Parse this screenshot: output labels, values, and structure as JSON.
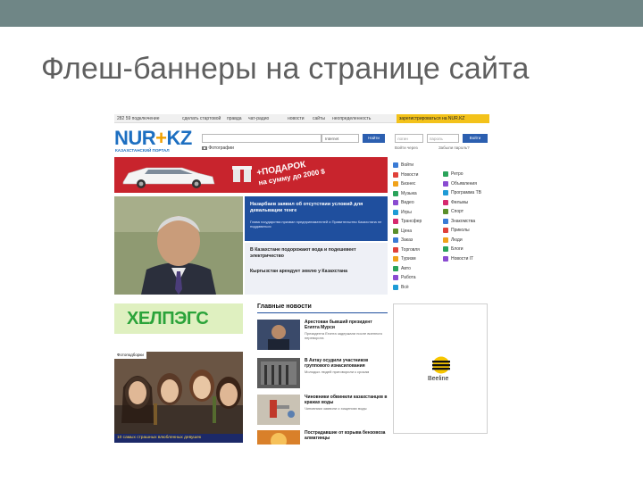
{
  "slide": {
    "title": "Флеш-баннеры на странице сайта"
  },
  "site": {
    "topbar": {
      "phone": "282 59 подключение",
      "links": [
        "сделать стартовой",
        "правда",
        "чат-радио",
        "новости",
        "сайты",
        "неопределенность"
      ],
      "register": "зарегистрироваться на NUR.KZ"
    },
    "logo": {
      "brand_left": "NUR",
      "brand_plus": "+",
      "brand_right": "KZ",
      "subtitle": "КАЗАХСТАНСКИЙ ПОРТАЛ"
    },
    "search": {
      "placeholder": "",
      "scope": "Internet",
      "button": "Найти",
      "photos_link": "Фотографии"
    },
    "login": {
      "login_placeholder": "логин",
      "password_placeholder": "пароль",
      "button": "Войти",
      "remember": "Войти через",
      "forgot": "Забыли пароль?"
    },
    "promo": {
      "line1": "+ПОДАРОК",
      "line2": "на сумму до 2000 $"
    },
    "feature": {
      "headline": "Назарбаев заявил об отсутствии условий для девальвации тенге",
      "subhead": "Глава государства призвал предпринимателей и Правительство Казахстана не поддаваться",
      "items": [
        "В Казахстане подорожают вода и подешевеет электричество",
        "Кыргызстан арендует землю у Казахстана"
      ]
    },
    "menu": {
      "col1": [
        "Войти",
        "Новости",
        "Бизнес",
        "Музыка",
        "Видео",
        "Игры",
        "Трансфер",
        "Ценa",
        "Заказ",
        "Торговля",
        "Туризм",
        "Авто",
        "Работа",
        "Всё"
      ],
      "col2": [
        "Ретро",
        "Объявления",
        "Программа ТВ",
        "Фильмы",
        "Спорт",
        "Знакомства",
        "Приколы",
        "Люди",
        "Блоги",
        "Новости IT"
      ]
    },
    "helpegs": {
      "text": "ХЕЛПЭГС"
    },
    "news": {
      "heading": "Главные новости",
      "items": [
        {
          "title": "Арестован бывший президент Египта Мурси",
          "desc": "Президента Египта задержали после военного переворота"
        },
        {
          "title": "В Актау осудили участников группового изнасилования",
          "desc": "Молодых людей приговорили к срокам"
        },
        {
          "title": "Чиновники обвинили казахстанцев в кражах воды",
          "desc": "Чиновники заявили о хищениях воды"
        },
        {
          "title": "Пострадавшие от взрыва бензовоза алматинцы",
          "desc": ""
        }
      ]
    },
    "girls": {
      "label": "Фотоподборки",
      "caption": "10 самых страшных влюбленных девушек"
    },
    "beeline": {
      "text": "Beeline"
    }
  },
  "colors": {
    "slide_bar": "#6f8686",
    "brand_blue": "#1d6fc1",
    "promo_red": "#c8242d",
    "feature_blue": "#1f4f9e",
    "register_yellow": "#f3c21a",
    "helpegs_green": "#2ba33a",
    "beeline_yellow": "#f7c600"
  }
}
